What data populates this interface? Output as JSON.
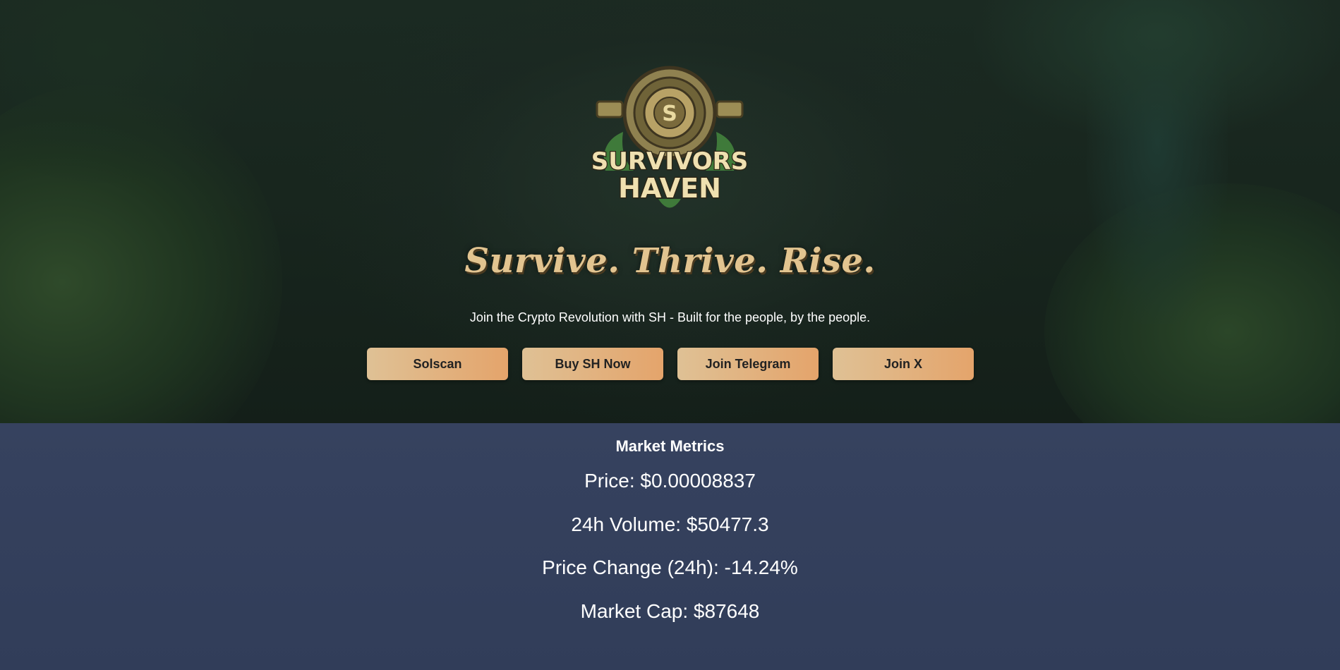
{
  "hero": {
    "logo": {
      "icon": "survivors-haven-emblem",
      "line1": "SURVIVORS",
      "line2": "HAVEN"
    },
    "tagline": "Survive. Thrive. Rise.",
    "subtitle": "Join the Crypto Revolution with SH - Built for the people, by the people.",
    "buttons": [
      {
        "label": "Solscan"
      },
      {
        "label": "Buy SH Now"
      },
      {
        "label": "Join Telegram"
      },
      {
        "label": "Join X"
      }
    ]
  },
  "metrics": {
    "title": "Market Metrics",
    "price": "Price: $0.00008837",
    "volume": "24h Volume: $50477.3",
    "change": "Price Change (24h): -14.24%",
    "market_cap": "Market Cap: $87648"
  },
  "colors": {
    "tagline": "#e2c490",
    "button_start": "#dfc195",
    "button_end": "#e4a46b",
    "metrics_bg": "#34405c"
  }
}
